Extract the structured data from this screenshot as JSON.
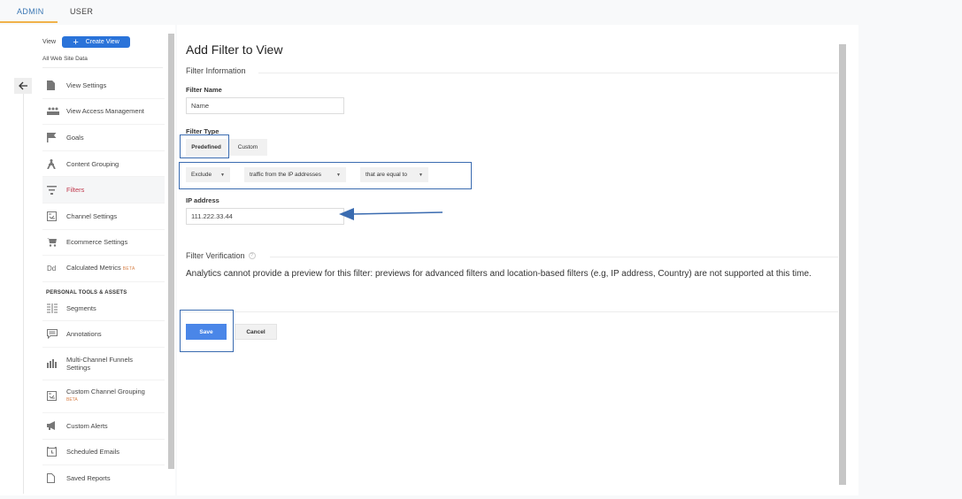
{
  "top_tabs": [
    {
      "label": "ADMIN",
      "active": true
    },
    {
      "label": "USER",
      "active": false
    }
  ],
  "admin": {
    "view_label": "View",
    "create_view_label": "Create View",
    "view_name": "All Web Site Data",
    "nav_items": [
      {
        "label": "View Settings",
        "icon": "document-icon"
      },
      {
        "label": "View Access Management",
        "icon": "people-icon"
      },
      {
        "label": "Goals",
        "icon": "flag-icon"
      },
      {
        "label": "Content Grouping",
        "icon": "person-walk-icon"
      },
      {
        "label": "Filters",
        "icon": "funnel-icon",
        "active": true
      },
      {
        "label": "Channel Settings",
        "icon": "channel-icon"
      },
      {
        "label": "Ecommerce Settings",
        "icon": "cart-icon"
      },
      {
        "label": "Calculated Metrics",
        "icon": "dd-icon",
        "badge": "BETA"
      }
    ],
    "section_header": "PERSONAL TOOLS & ASSETS",
    "personal_items": [
      {
        "label": "Segments",
        "icon": "segments-icon"
      },
      {
        "label": "Annotations",
        "icon": "comment-icon"
      },
      {
        "label": "Multi-Channel Funnels Settings",
        "icon": "bar-chart-icon"
      },
      {
        "label": "Custom Channel Grouping",
        "icon": "channel-icon",
        "badge": "BETA"
      },
      {
        "label": "Custom Alerts",
        "icon": "megaphone-icon"
      },
      {
        "label": "Scheduled Emails",
        "icon": "alarm-icon"
      },
      {
        "label": "Saved Reports",
        "icon": "file-icon"
      }
    ]
  },
  "form": {
    "title": "Add Filter to View",
    "filter_info_title": "Filter Information",
    "filter_name_label": "Filter Name",
    "filter_name_value": "Name",
    "filter_type_label": "Filter Type",
    "type_predefined": "Predefined",
    "type_custom": "Custom",
    "selected_type": "Predefined",
    "dropdown_action": "Exclude",
    "dropdown_source": "traffic from the IP addresses",
    "dropdown_expression": "that are equal to",
    "ip_label": "IP address",
    "ip_value": "111.222.33.44",
    "verification_title": "Filter Verification",
    "help_glyph": "?",
    "verification_text": "Analytics cannot provide a preview for this filter: previews for advanced filters and location-based filters (e.g, IP address, Country) are not supported at this time.",
    "save_label": "Save",
    "cancel_label": "Cancel"
  },
  "annotation": {
    "highlight_color": "#3a6bb0",
    "arrow_color": "#3a6bb0"
  }
}
